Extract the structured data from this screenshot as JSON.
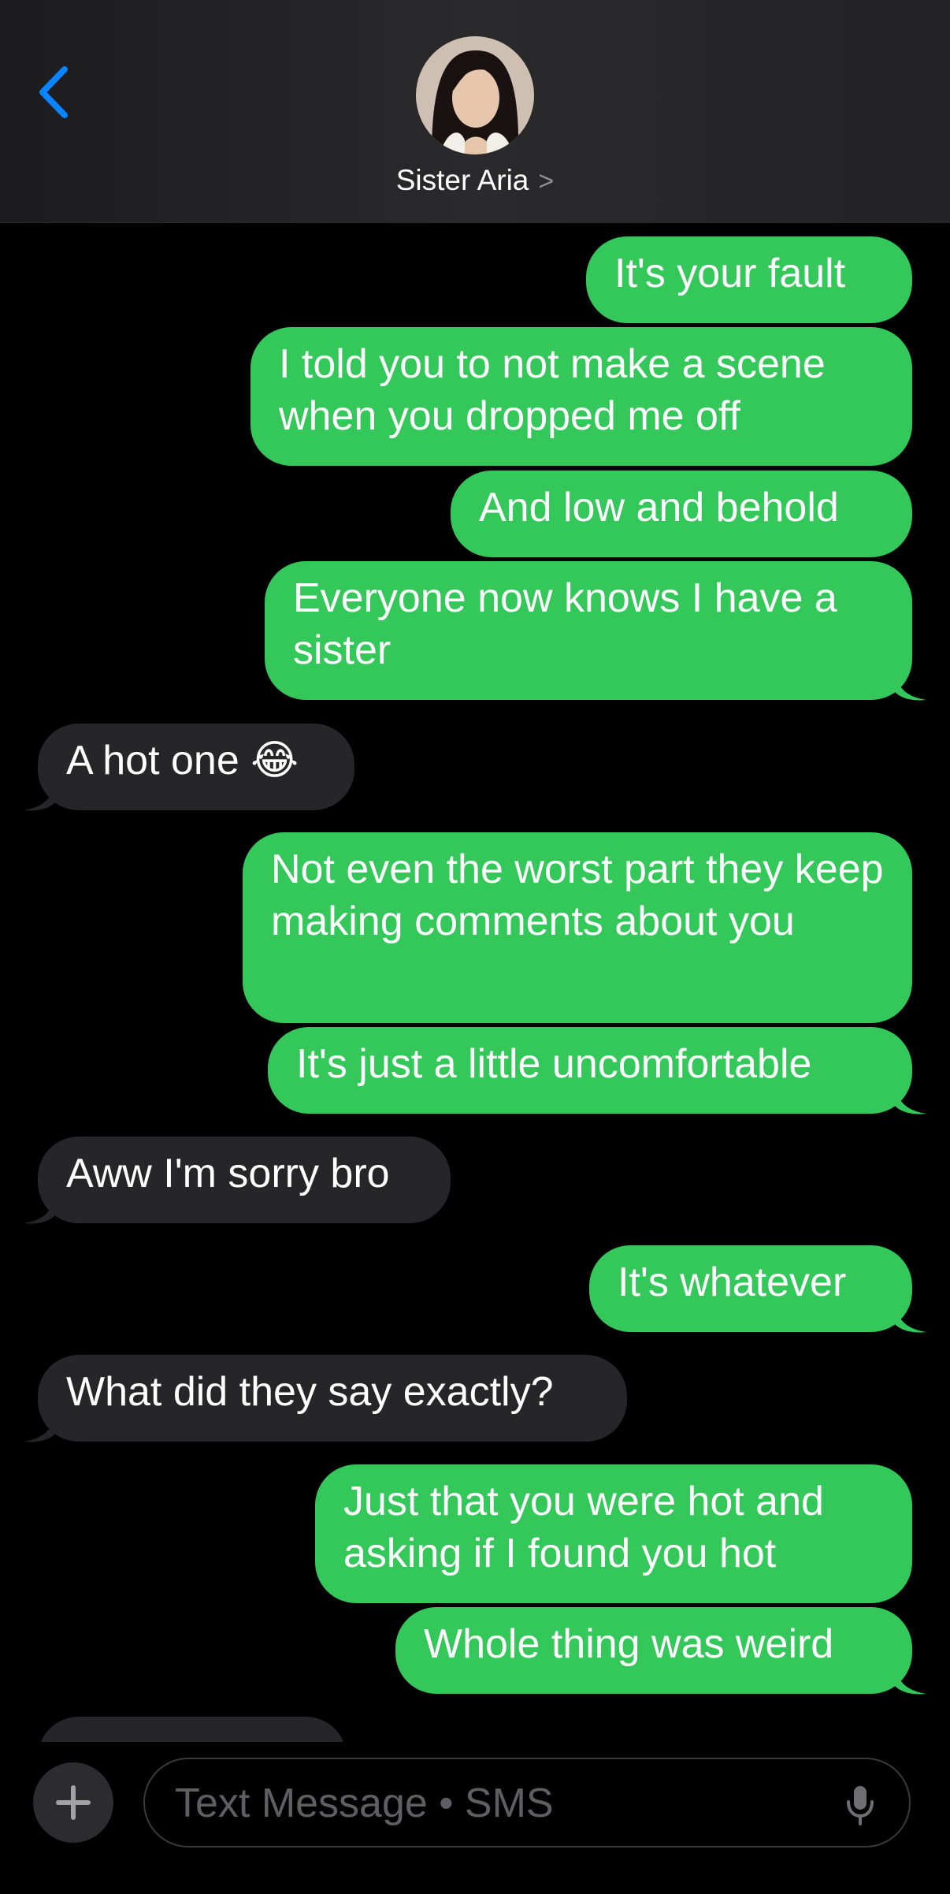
{
  "header": {
    "contact_name": "Sister Aria",
    "chevron": ">"
  },
  "messages": [
    {
      "side": "sent",
      "text": "It's your fault"
    },
    {
      "side": "sent",
      "text": "I told you to not make a scene when you dropped me off"
    },
    {
      "side": "sent",
      "text": "And low and behold"
    },
    {
      "side": "sent",
      "text": "Everyone now knows I have a sister"
    },
    {
      "side": "received",
      "text": "A hot one 😂"
    },
    {
      "side": "sent",
      "text": "Not even the worst part they keep making comments about you"
    },
    {
      "side": "sent",
      "text": "It's just a little uncomfortable"
    },
    {
      "side": "received",
      "text": "Aww I'm sorry bro"
    },
    {
      "side": "sent",
      "text": "It's whatever"
    },
    {
      "side": "received",
      "text": "What did they say exactly?"
    },
    {
      "side": "sent",
      "text": "Just that you were hot and asking if I found you hot"
    },
    {
      "side": "sent",
      "text": "Whole thing was weird"
    },
    {
      "side": "received",
      "text": ""
    }
  ],
  "composer": {
    "placeholder": "Text Message • SMS",
    "value": ""
  },
  "icons": {
    "back": "chevron-left-icon",
    "add": "plus-icon",
    "mic": "microphone-icon"
  },
  "colors": {
    "sent_bubble": "#34c759",
    "received_bubble": "#262628",
    "accent": "#0a84ff",
    "background": "#000000"
  }
}
